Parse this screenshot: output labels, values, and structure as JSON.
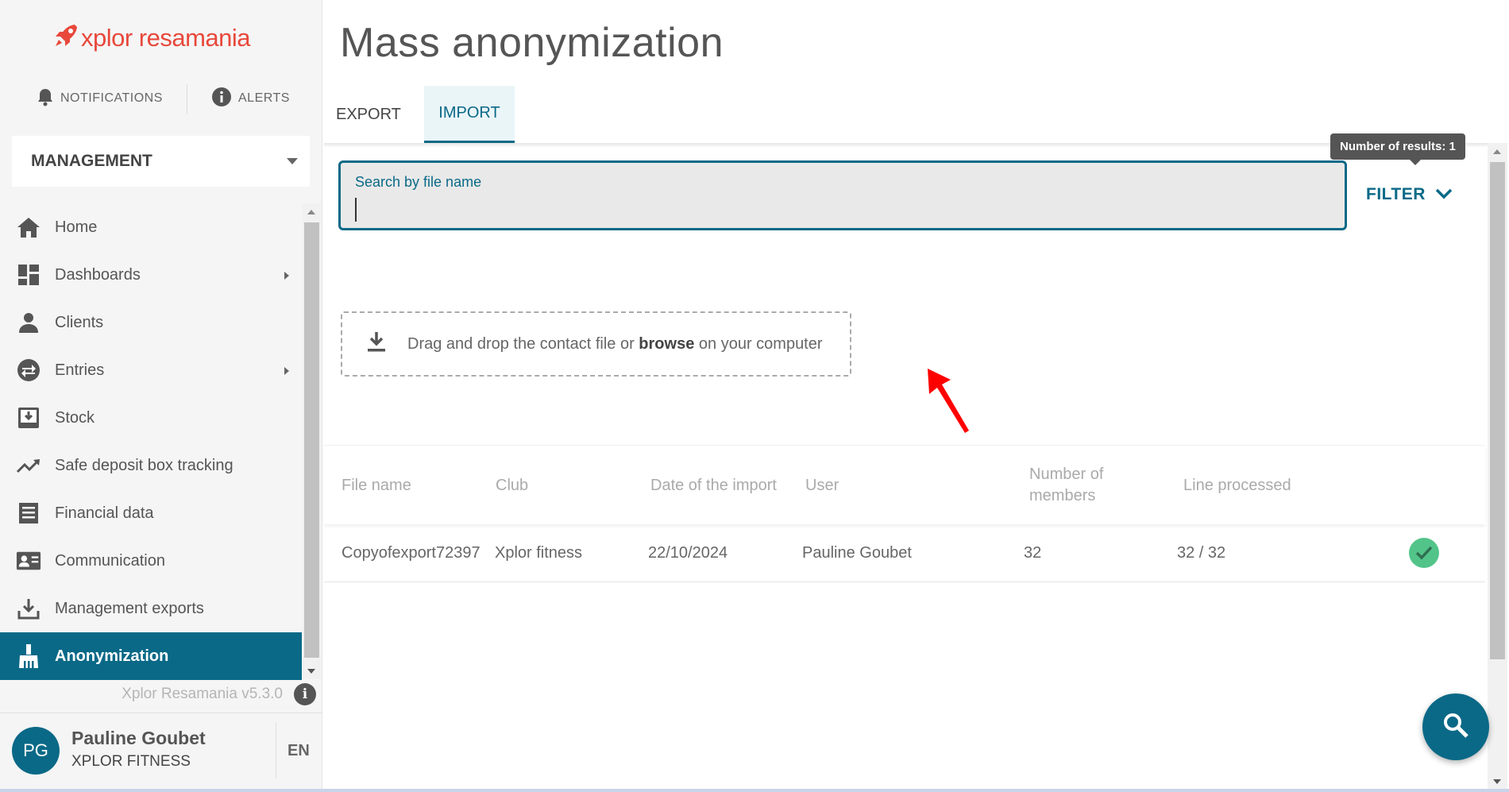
{
  "brand": {
    "logo_text": "xplor resamania",
    "accent_color": "#0a6987",
    "logo_color": "#e8483b",
    "success_color": "#52c48a"
  },
  "topbar": {
    "notifications_label": "NOTIFICATIONS",
    "alerts_label": "ALERTS"
  },
  "section_select": {
    "value": "MANAGEMENT"
  },
  "sidebar": {
    "items": [
      {
        "label": "Home",
        "icon": "home-icon"
      },
      {
        "label": "Dashboards",
        "icon": "dashboard-icon",
        "has_submenu": true
      },
      {
        "label": "Clients",
        "icon": "person-icon"
      },
      {
        "label": "Entries",
        "icon": "swap-icon",
        "has_submenu": true
      },
      {
        "label": "Stock",
        "icon": "inventory-icon"
      },
      {
        "label": "Safe deposit box tracking",
        "icon": "trending-up-icon"
      },
      {
        "label": "Financial data",
        "icon": "list-icon"
      },
      {
        "label": "Communication",
        "icon": "contact-card-icon"
      },
      {
        "label": "Management exports",
        "icon": "download-icon"
      },
      {
        "label": "Anonymization",
        "icon": "broom-icon",
        "active": true
      }
    ],
    "version": "Xplor Resamania v5.3.0"
  },
  "user": {
    "initials": "PG",
    "name": "Pauline Goubet",
    "club": "XPLOR FITNESS",
    "language": "EN"
  },
  "page": {
    "title": "Mass anonymization",
    "tabs": [
      {
        "label": "EXPORT",
        "active": false
      },
      {
        "label": "IMPORT",
        "active": true
      }
    ]
  },
  "results": {
    "tooltip": "Number of results: 1"
  },
  "search": {
    "label": "Search by file name",
    "value": ""
  },
  "filter": {
    "label": "FILTER"
  },
  "dropzone": {
    "text_before": "Drag and drop the contact file or",
    "link": "browse",
    "text_after": "on your computer"
  },
  "table": {
    "columns": [
      "File name",
      "Club",
      "Date of the import",
      "User",
      "Number of members",
      "Line processed"
    ],
    "rows": [
      {
        "file_name": "Copyofexport72397",
        "club": "Xplor fitness",
        "date": "22/10/2024",
        "user": "Pauline Goubet",
        "members": "32",
        "lines": "32 / 32",
        "status": "success"
      }
    ]
  }
}
